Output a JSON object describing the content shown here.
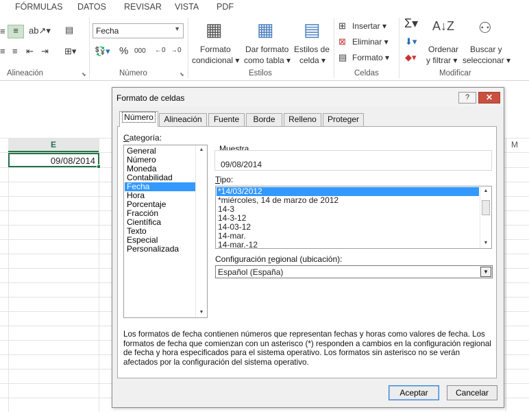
{
  "menu": {
    "tabs": [
      "FÓRMULAS",
      "DATOS",
      "REVISAR",
      "VISTA",
      "PDF"
    ]
  },
  "ribbon": {
    "groups": {
      "alineacion": "Alineación",
      "numero": "Número",
      "estilos": "Estilos",
      "celdas": "Celdas",
      "modificar": "Modificar"
    },
    "number_format": "Fecha",
    "percent_symbol": "%",
    "thousands_symbol": "000",
    "styles": {
      "conditional": [
        "Formato",
        "condicional"
      ],
      "as_table": [
        "Dar formato",
        "como tabla"
      ],
      "cell_styles": [
        "Estilos de",
        "celda"
      ]
    },
    "cells": {
      "insert": "Insertar",
      "delete": "Eliminar",
      "format": "Formato"
    },
    "editing": {
      "sort": [
        "Ordenar",
        "y filtrar"
      ],
      "find": [
        "Buscar y",
        "seleccionar"
      ]
    }
  },
  "sheet": {
    "column_selected": "E",
    "column_other": "M",
    "cell_value": "09/08/2014"
  },
  "dialog": {
    "title": "Formato de celdas",
    "help_label": "?",
    "close_label": "✕",
    "tabs": [
      "Número",
      "Alineación",
      "Fuente",
      "Borde",
      "Relleno",
      "Proteger"
    ],
    "categoria_label": {
      "pre": "",
      "key": "C",
      "post": "ategoría:"
    },
    "categories": [
      "General",
      "Número",
      "Moneda",
      "Contabilidad",
      "Fecha",
      "Hora",
      "Porcentaje",
      "Fracción",
      "Científica",
      "Texto",
      "Especial",
      "Personalizada"
    ],
    "selected_category": "Fecha",
    "muestra_label": "Muestra",
    "muestra_value": "09/08/2014",
    "tipo_label": {
      "pre": "",
      "key": "T",
      "post": "ipo:"
    },
    "tipos": [
      "*14/03/2012",
      "*miércoles, 14 de marzo de 2012",
      "14-3",
      "14-3-12",
      "14-03-12",
      "14-mar.",
      "14-mar.-12"
    ],
    "selected_tipo": "*14/03/2012",
    "regional_label": {
      "pre": "Configuración ",
      "key": "r",
      "post": "egional (ubicación):"
    },
    "regional_value": "Español (España)",
    "description": "Los formatos de fecha contienen números que representan fechas y horas como valores de fecha. Los formatos de fecha que comienzan con un asterisco (*) responden a cambios en la configuración regional de fecha y hora especificados para el sistema operativo. Los formatos sin asterisco no se verán afectados por la configuración del sistema operativo.",
    "ok_label": "Aceptar",
    "cancel_label": "Cancelar"
  }
}
